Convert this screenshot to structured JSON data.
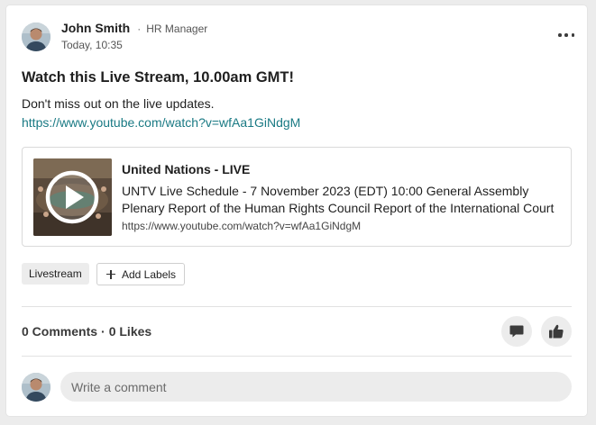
{
  "post": {
    "author": {
      "name": "John Smith",
      "separator": "·",
      "role": "HR Manager"
    },
    "timestamp": "Today, 10:35",
    "title": "Watch this Live Stream, 10.00am GMT!",
    "body": "Don't miss out on the live updates.",
    "link": "https://www.youtube.com/watch?v=wfAa1GiNdgM",
    "preview": {
      "title": "United Nations - LIVE",
      "description": "UNTV Live Schedule - 7 November 2023 (EDT) 10:00 General Assembly Plenary Report of the Human Rights Council Report of the International Court of",
      "url": "https://www.youtube.com/watch?v=wfAa1GiNdgM",
      "thumbnail_icon": "play-icon"
    },
    "labels": [
      "Livestream"
    ],
    "add_labels_label": "Add Labels"
  },
  "stats": {
    "comments": "0 Comments",
    "separator": "·",
    "likes": "0 Likes"
  },
  "actions": {
    "comment_icon": "comment-icon",
    "like_icon": "thumbs-up-icon",
    "more_icon": "more-dots-icon"
  },
  "comment_box": {
    "placeholder": "Write a comment",
    "value": ""
  },
  "colors": {
    "link": "#1a7a84",
    "chip_background": "#ececec",
    "card_background": "#ffffff",
    "page_background": "#ececec"
  }
}
